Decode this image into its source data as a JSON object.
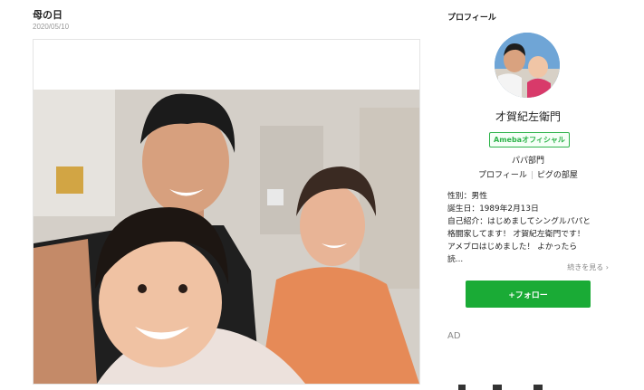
{
  "post": {
    "title": "母の日",
    "date": "2020/05/10"
  },
  "sidebar": {
    "heading": "プロフィール",
    "blogger_name": "才賀紀左衛門",
    "official_badge": "Amebaオフィシャル",
    "category": "パパ部門",
    "links": [
      "プロフィール",
      "ピグの部屋"
    ],
    "info": {
      "gender": "性別：男性",
      "birthday": "誕生日：1989年2月13日",
      "intro": "自己紹介：はじめましてシングルパパと格闘家してます！ 才賀紀左衛門です！ アメブロはじめました！ よかったら読..."
    },
    "more_link": "続きを見る",
    "follow_button": "+フォロー",
    "ad_label": "AD"
  },
  "colors": {
    "accent_green": "#1aab36",
    "badge_green": "#2db34a",
    "muted_text": "#888888"
  }
}
